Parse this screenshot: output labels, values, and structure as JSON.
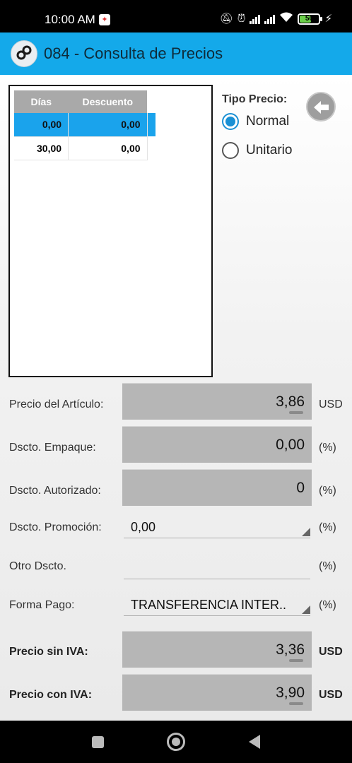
{
  "status_bar": {
    "time": "10:00 AM",
    "battery": "56"
  },
  "app_bar": {
    "title": "084 - Consulta de Precios"
  },
  "discount_table": {
    "headers": [
      "Días",
      "Descuento"
    ],
    "rows": [
      {
        "dias": "0,00",
        "descuento": "0,00",
        "selected": true
      },
      {
        "dias": "30,00",
        "descuento": "0,00",
        "selected": false
      }
    ]
  },
  "tipo_precio": {
    "label": "Tipo Precio:",
    "options": [
      {
        "label": "Normal",
        "checked": true
      },
      {
        "label": "Unitario",
        "checked": false
      }
    ]
  },
  "fields": {
    "precio_articulo": {
      "label": "Precio del Artículo:",
      "value": "3,86",
      "unit": "USD"
    },
    "dscto_empaque": {
      "label": "Dscto. Empaque:",
      "value": "0,00",
      "unit": "(%)"
    },
    "dscto_autorizado": {
      "label": "Dscto. Autorizado:",
      "value": "0",
      "unit": "(%)"
    },
    "dscto_promocion": {
      "label": "Dscto. Promoción:",
      "value": "0,00",
      "unit": "(%)"
    },
    "otro_dscto": {
      "label": "Otro Dscto.",
      "value": "",
      "unit": "(%)"
    },
    "forma_pago": {
      "label": "Forma Pago:",
      "value": "TRANSFERENCIA INTER..",
      "unit": "(%)"
    },
    "precio_sin_iva": {
      "label": "Precio sin IVA:",
      "value": "3,36",
      "unit": "USD"
    },
    "precio_con_iva": {
      "label": "Precio con IVA:",
      "value": "3,90",
      "unit": "USD"
    }
  },
  "colors": {
    "app_bar": "#14a9ea",
    "selected_row": "#1aa3ec",
    "radio_checked": "#1a90d4"
  }
}
